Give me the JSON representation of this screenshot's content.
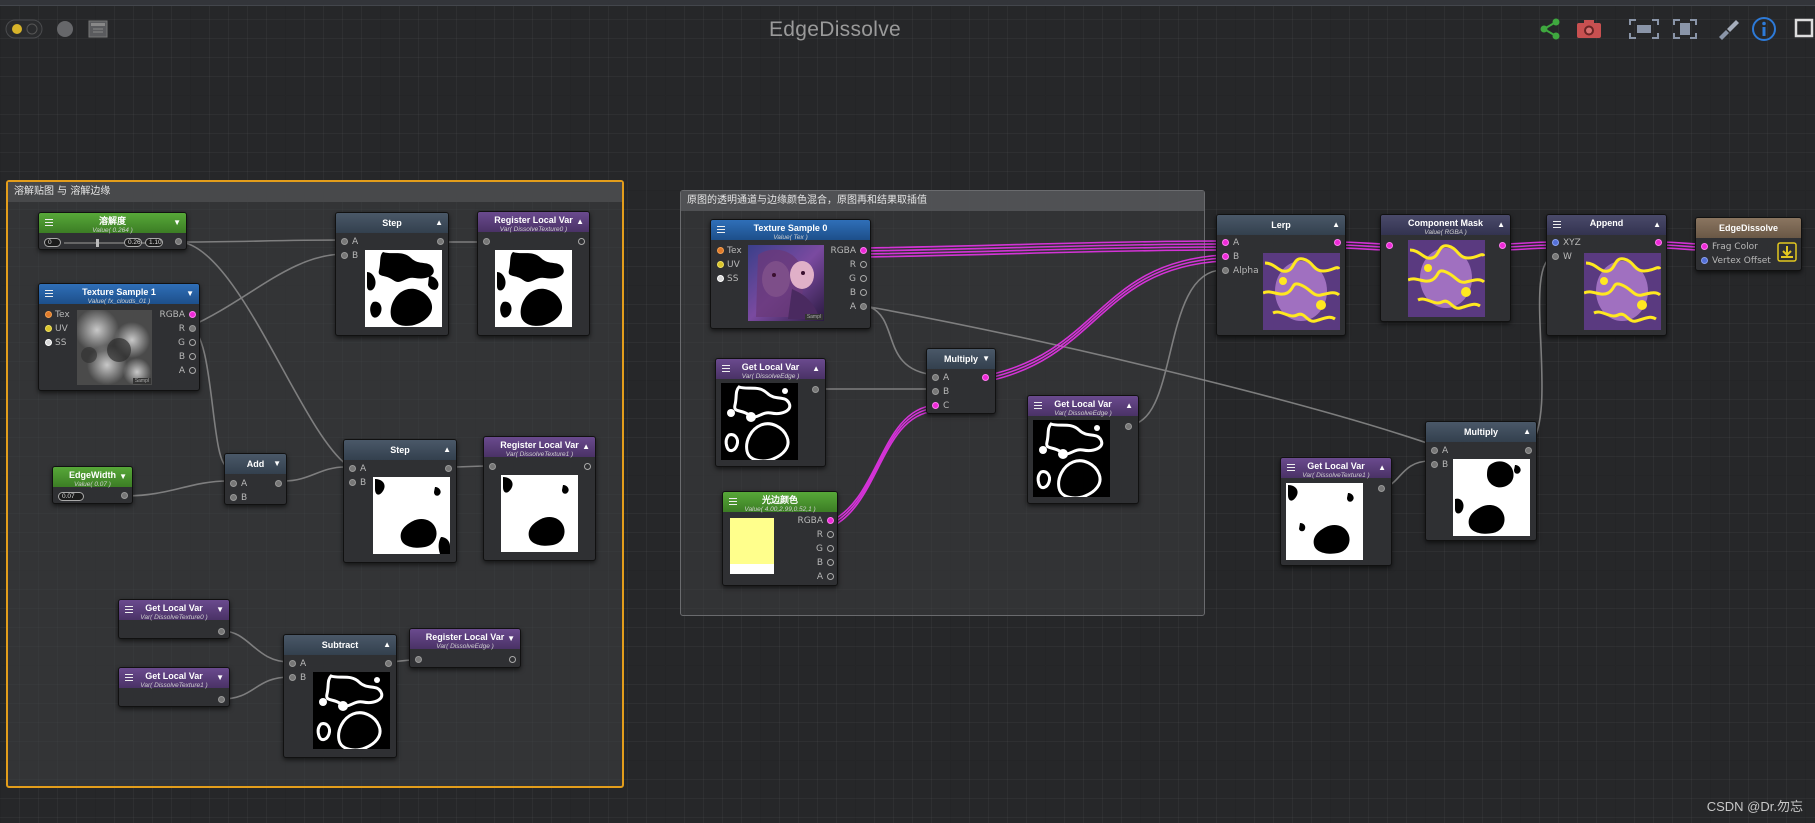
{
  "window": {
    "title": "EdgeDissolve",
    "watermark": "CSDN @Dr.勿忘"
  },
  "toolbar": {
    "left_icons": [
      "live-toggle-icon",
      "circle-icon",
      "grid-window-icon"
    ],
    "right_icons": [
      "share-icon",
      "camera-icon",
      "focus-icon",
      "frame-icon",
      "brush-icon",
      "info-icon",
      "maximize-icon"
    ],
    "colors": {
      "share": "#3fa83f",
      "camera": "#c85050",
      "tools": "#8a95a8",
      "info": "#2d7ad8"
    }
  },
  "groups": [
    {
      "title": "溶解贴图 与 溶解边缘",
      "border": "#e39d1b"
    },
    {
      "title": "原图的透明通道与边缘颜色混合，原图再和结果取插值",
      "border": "#6a6b6e"
    }
  ],
  "nodes": {
    "dissolve_amount": {
      "title": "溶解度",
      "sub": "Value( 0.264 )",
      "min": "0",
      "value": "0.26",
      "max": "1.10"
    },
    "tex_sample1": {
      "title": "Texture Sample 1",
      "sub": "Value( fx_clouds_01 )",
      "inputs": [
        "Tex",
        "UV",
        "SS"
      ],
      "outputs": [
        "RGBA",
        "R",
        "G",
        "B",
        "A"
      ],
      "badge": "Sampl"
    },
    "edge_width": {
      "title": "EdgeWidth",
      "sub": "Value( 0.07 )",
      "value": "0.07"
    },
    "add": {
      "title": "Add",
      "inputs": [
        "A",
        "B"
      ]
    },
    "step1": {
      "title": "Step",
      "inputs": [
        "A",
        "B"
      ]
    },
    "step2": {
      "title": "Step",
      "inputs": [
        "A",
        "B"
      ]
    },
    "reg_tex0": {
      "title": "Register Local Var",
      "sub": "Var( DissolveTexture0 )"
    },
    "reg_tex1": {
      "title": "Register Local Var",
      "sub": "Var( DissolveTexture1 )"
    },
    "get_tex0": {
      "title": "Get Local Var",
      "sub": "Var( DissolveTexture0 )"
    },
    "get_tex1": {
      "title": "Get Local Var",
      "sub": "Var( DissolveTexture1 )"
    },
    "subtract": {
      "title": "Subtract",
      "inputs": [
        "A",
        "B"
      ]
    },
    "reg_edge": {
      "title": "Register Local Var",
      "sub": "Var( DissolveEdge )"
    },
    "tex_sample0": {
      "title": "Texture Sample 0",
      "sub": "Value( Tex )",
      "inputs": [
        "Tex",
        "UV",
        "SS"
      ],
      "outputs": [
        "RGBA",
        "R",
        "G",
        "B",
        "A"
      ],
      "badge": "Sampl"
    },
    "get_edge1": {
      "title": "Get Local Var",
      "sub": "Var( DissolveEdge )"
    },
    "edge_color": {
      "title": "光边颜色",
      "sub": "Value( 4.00,2.99,0.52,1 )",
      "outputs": [
        "RGBA",
        "R",
        "G",
        "B",
        "A"
      ],
      "swatch": "#ffff8c"
    },
    "multiply1": {
      "title": "Multiply",
      "inputs": [
        "A",
        "B",
        "C"
      ]
    },
    "get_edge2": {
      "title": "Get Local Var",
      "sub": "Var( DissolveEdge )"
    },
    "lerp": {
      "title": "Lerp",
      "inputs": [
        "A",
        "B",
        "Alpha"
      ]
    },
    "component_mask": {
      "title": "Component Mask",
      "sub": "Value( RGBA )"
    },
    "append": {
      "title": "Append",
      "inputs": [
        "XYZ",
        "W"
      ]
    },
    "output": {
      "title": "EdgeDissolve",
      "inputs": [
        "Frag Color",
        "Vertex Offset"
      ]
    },
    "get_tex1b": {
      "title": "Get Local Var",
      "sub": "Var( DissolveTexture1 )"
    },
    "multiply2": {
      "title": "Multiply",
      "inputs": [
        "A",
        "B"
      ]
    }
  },
  "colors": {
    "canvas": "#262729",
    "magenta_wire": "#dd33e0",
    "gray_wire": "#8c8c8c"
  }
}
